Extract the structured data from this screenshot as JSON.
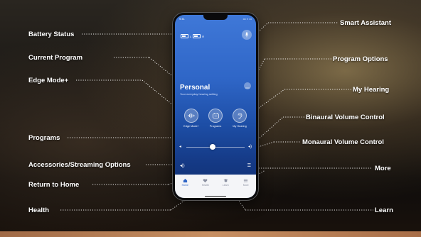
{
  "callouts": {
    "battery_status": "Battery Status",
    "current_program": "Current Program",
    "edge_mode": "Edge Mode+",
    "programs": "Programs",
    "accessories": "Accessories/Streaming Options",
    "return_home": "Return to Home",
    "health": "Health",
    "smart_assistant": "Smart Assistant",
    "program_options": "Program Options",
    "my_hearing": "My Hearing",
    "binaural_volume": "Binaural Volume Control",
    "monaural_volume": "Monaural Volume Control",
    "more": "More",
    "learn": "Learn"
  },
  "phone": {
    "status_time": "9:41",
    "status_right": "••• ≈ ▭",
    "battery_left": "L",
    "battery_right": "R",
    "program_name": "Personal",
    "program_subtitle": "Your everyday hearing setting",
    "buttons": [
      {
        "label": "Edge Mode+",
        "icon": "waveform-icon"
      },
      {
        "label": "Programs",
        "icon": "programs-icon"
      },
      {
        "label": "My Hearing",
        "icon": "ear-icon"
      }
    ],
    "volume_level": 0.45,
    "tabs": [
      {
        "label": "Home",
        "icon": "home-icon",
        "active": true
      },
      {
        "label": "Health",
        "icon": "heart-icon",
        "active": false
      },
      {
        "label": "Learn",
        "icon": "graduation-cap-icon",
        "active": false
      },
      {
        "label": "More",
        "icon": "menu-icon",
        "active": false
      }
    ]
  },
  "colors": {
    "accent": "#2f66c7",
    "tab_bg": "#f4f5f8"
  }
}
